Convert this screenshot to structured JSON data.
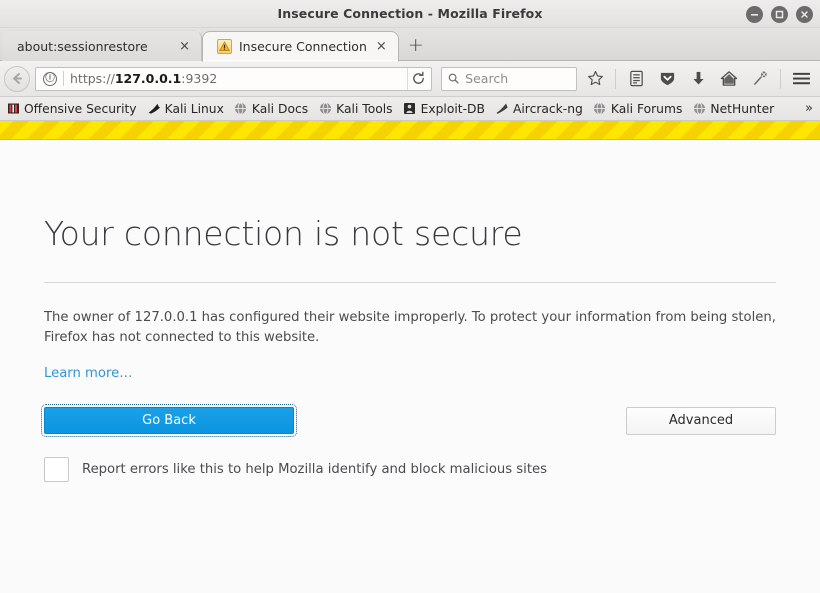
{
  "window": {
    "title": "Insecure Connection - Mozilla Firefox",
    "controls": {
      "minimize": "minimize-button",
      "maximize": "maximize-button",
      "close": "close-button"
    }
  },
  "tabs": [
    {
      "label": "about:sessionrestore",
      "close": "×",
      "active": false,
      "favicon": "none"
    },
    {
      "label": "Insecure Connection",
      "close": "×",
      "active": true,
      "favicon": "warning-icon"
    }
  ],
  "newtab_label": "+",
  "toolbar": {
    "back_icon": "back-arrow-icon",
    "identity_icon": "ⓘ",
    "url": {
      "scheme": "https://",
      "host": "127.0.0.1",
      "port": ":9392"
    },
    "reload_icon": "reload-icon",
    "search_placeholder": "Search",
    "search_value": "",
    "icons": [
      "bookmark-star-icon",
      "reader-list-icon",
      "pocket-shield-icon",
      "downloads-icon",
      "home-icon",
      "sync-icon",
      "menu-icon"
    ]
  },
  "bookmarks": {
    "items": [
      {
        "label": "Offensive Security",
        "icon": "book-icon"
      },
      {
        "label": "Kali Linux",
        "icon": "dragon-icon"
      },
      {
        "label": "Kali Docs",
        "icon": "globe-icon"
      },
      {
        "label": "Kali Tools",
        "icon": "globe-icon"
      },
      {
        "label": "Exploit-DB",
        "icon": "exploitdb-icon"
      },
      {
        "label": "Aircrack-ng",
        "icon": "aircrack-icon"
      },
      {
        "label": "Kali Forums",
        "icon": "globe-icon"
      },
      {
        "label": "NetHunter",
        "icon": "globe-icon"
      }
    ],
    "overflow": "»"
  },
  "page": {
    "headline": "Your connection is not secure",
    "body": "The owner of 127.0.0.1 has configured their website improperly. To protect your information from being stolen, Firefox has not connected to this website.",
    "learn_more": "Learn more…",
    "go_back_label": "Go Back",
    "advanced_label": "Advanced",
    "report_label": "Report errors like this to help Mozilla identify and block malicious sites",
    "report_checked": false
  },
  "colors": {
    "primary_button": "#0a96e0",
    "link": "#3394d2",
    "caution_stripe": "#ffe600",
    "page_background": "#fbfbfb"
  }
}
